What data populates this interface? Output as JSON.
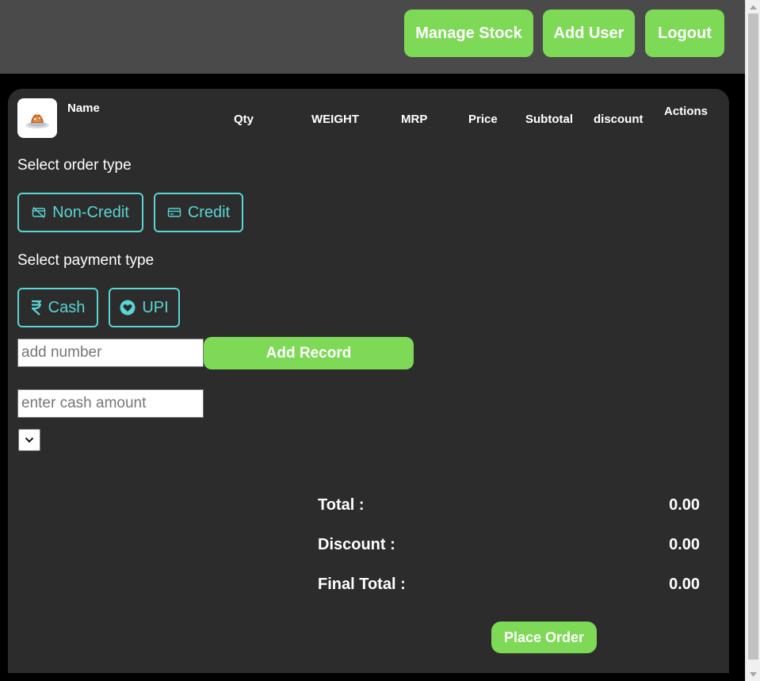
{
  "header": {
    "manage_stock": "Manage Stock",
    "add_user": "Add User",
    "logout": "Logout"
  },
  "table": {
    "columns": [
      "Name",
      "Qty",
      "WEIGHT",
      "MRP",
      "Price",
      "Subtotal",
      "discount",
      "Actions"
    ]
  },
  "order_type": {
    "label": "Select order type",
    "non_credit": "Non-Credit",
    "credit": "Credit"
  },
  "payment_type": {
    "label": "Select payment type",
    "cash": "Cash",
    "upi": "UPI"
  },
  "record": {
    "number_placeholder": "add number",
    "add_button": "Add Record",
    "cash_placeholder": "enter cash amount"
  },
  "totals": {
    "total_label": "Total :",
    "total_value": "0.00",
    "discount_label": "Discount :",
    "discount_value": "0.00",
    "final_label": "Final Total :",
    "final_value": "0.00"
  },
  "place_order": "Place Order",
  "colors": {
    "accent_green": "#7ed957",
    "accent_teal": "#5ad4d4",
    "card_bg": "#2c2c2c",
    "topbar_bg": "#4a4a4a"
  }
}
